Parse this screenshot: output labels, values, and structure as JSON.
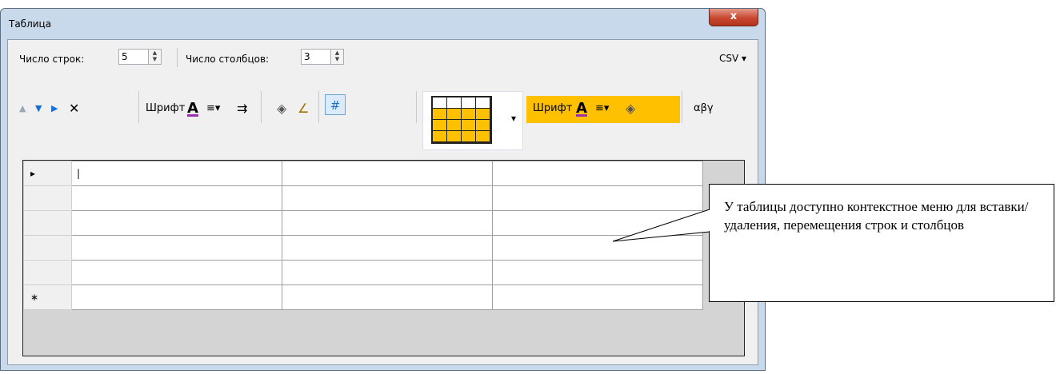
{
  "window": {
    "title": "Таблица",
    "close_glyph": "x"
  },
  "toolbar_row1": {
    "rows_label": "Число строк:",
    "rows_value": "5",
    "cols_label": "Число столбцов:",
    "cols_value": "3",
    "csv_label": "CSV ▾"
  },
  "toolbar_row2": {
    "move_up_glyph": "▲",
    "move_down_glyph": "▼",
    "insert_glyph": "▶",
    "delete_glyph": "✕",
    "font_label": "Шрифт",
    "font_color_glyph": "A",
    "align_glyph": "≡▾",
    "wrap_glyph": "⇉",
    "fill_glyph": "◈",
    "pen_glyph": "∠",
    "grid_glyph": "#",
    "preview_dropdown_glyph": "▾",
    "header_font_label": "Шрифт",
    "header_font_color_glyph": "A",
    "header_align_glyph": "≡▾",
    "header_fill_glyph": "◈",
    "symbols_label": "αβγ"
  },
  "grid": {
    "row_markers": [
      "▸",
      "",
      "",
      "",
      "",
      "∗"
    ],
    "cursor": "|"
  },
  "callout": {
    "text": "У таблицы доступно контекстное меню для вставки/удаления, перемещения строк и столбцов"
  }
}
